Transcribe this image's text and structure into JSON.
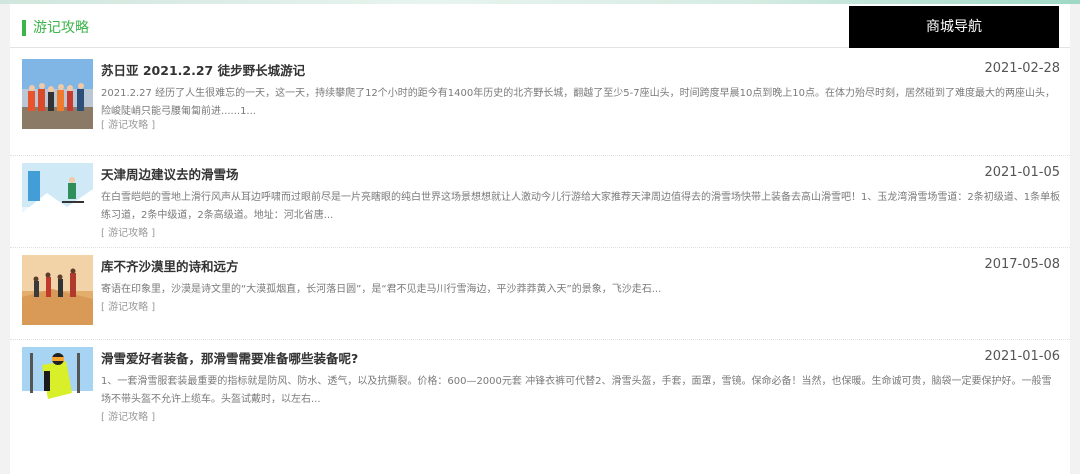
{
  "section": {
    "title": "游记攻略",
    "nav_button": "商城导航"
  },
  "articles": [
    {
      "title": "苏日亚 2021.2.27 徒步野长城游记",
      "date": "2021-02-28",
      "desc": "2021.2.27 经历了人生很难忘的一天，这一天，持续攀爬了12个小时的距今有1400年历史的北齐野长城，翻越了至少5-7座山头，时间跨度早晨10点到晚上10点。在体力殆尽时刻，居然碰到了难度最大的两座山头，险峻陡峭只能弓腰匍匐前进......1...",
      "tag": "[ 游记攻略 ]",
      "thumb": "hikers-photo"
    },
    {
      "title": "天津周边建议去的滑雪场",
      "date": "2021-01-05",
      "desc": "在白雪皑皑的雪地上滑行风声从耳边呼啸而过眼前尽是一片亮瞎眼的纯白世界这场景想想就让人激动今儿行游给大家推荐天津周边值得去的滑雪场快带上装备去高山滑雪吧！1、玉龙湾滑雪场雪道：2条初级道、1条单板练习道，2条中级道，2条高级道。地址：河北省唐...",
      "tag": "[ 游记攻略 ]",
      "thumb": "ski-poster"
    },
    {
      "title": "库不齐沙漠里的诗和远方",
      "date": "2017-05-08",
      "desc": "寄语在印象里，沙漠是诗文里的“大漠孤烟直，长河落日圆”，是“君不见走马川行雪海边，平沙莽莽黄入天”的景象，飞沙走石...",
      "tag": "[ 游记攻略 ]",
      "thumb": "desert-photo"
    },
    {
      "title": "滑雪爱好者装备，那滑雪需要准备哪些装备呢?",
      "date": "2021-01-06",
      "desc": "1、一套滑雪服套装最重要的指标就是防风、防水、透气，以及抗撕裂。价格：600—2000元套 冲锋衣裤可代替2、滑雪头盔，手套，面罩，雪镜。保命必备！当然，也保暖。生命诚可贵，脑袋一定要保护好。一般雪场不带头盔不允许上缆车。头盔试戴时，以左右...",
      "tag": "[ 游记攻略 ]",
      "thumb": "skier-photo"
    }
  ]
}
